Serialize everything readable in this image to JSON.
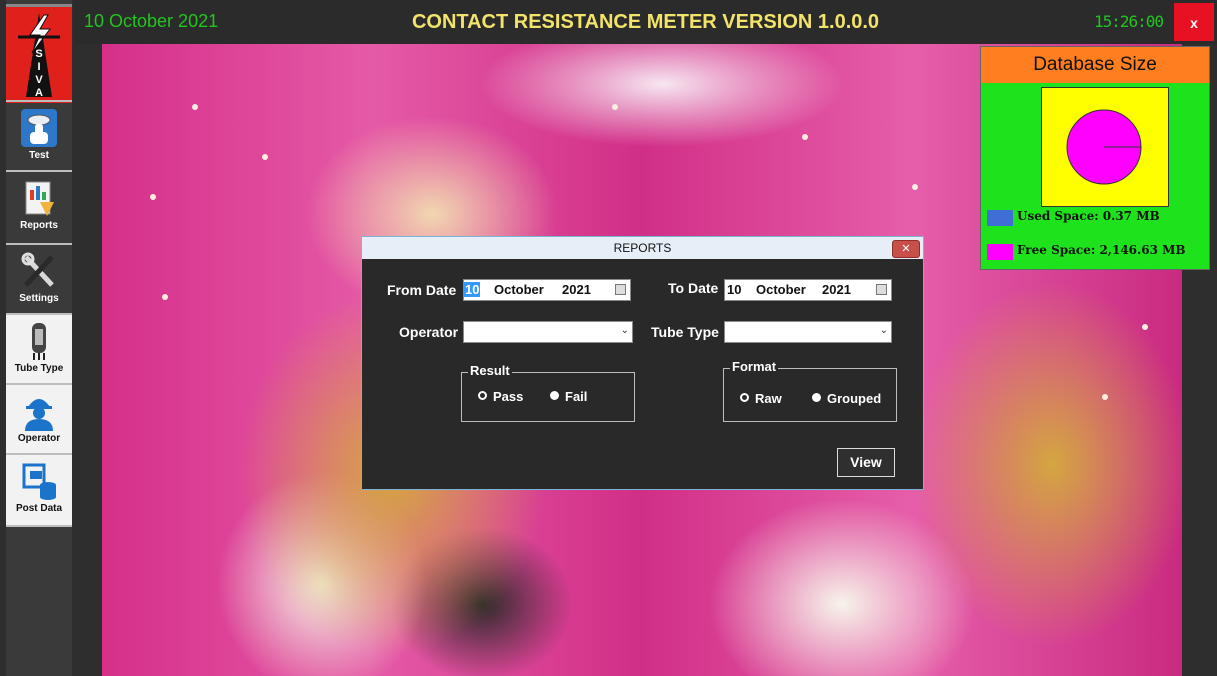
{
  "header": {
    "date": "10 October 2021",
    "title": "CONTACT RESISTANCE METER VERSION 1.0.0.0",
    "clock": "15:26:00",
    "close_label": "x"
  },
  "logo": {
    "letters": [
      "S",
      "I",
      "V",
      "A"
    ]
  },
  "sidebar": {
    "items": [
      {
        "label": "Test"
      },
      {
        "label": "Reports"
      },
      {
        "label": "Settings"
      },
      {
        "label": "Tube Type"
      },
      {
        "label": "Operator"
      },
      {
        "label": "Post Data"
      }
    ]
  },
  "database": {
    "title": "Database Size",
    "used_label": "Used Space: 0.37 MB",
    "free_label": "Free Space: 2,146.63 MB",
    "used_color": "#3f6fd6",
    "free_color": "#ff00ff"
  },
  "dialog": {
    "title": "REPORTS",
    "from_label": "From Date",
    "from_day": "10",
    "from_month": "October",
    "from_year": "2021",
    "to_label": "To Date",
    "to_day": "10",
    "to_month": "October",
    "to_year": "2021",
    "operator_label": "Operator",
    "operator_value": "",
    "tube_label": "Tube Type",
    "tube_value": "",
    "result_legend": "Result",
    "result_pass": "Pass",
    "result_fail": "Fail",
    "format_legend": "Format",
    "format_raw": "Raw",
    "format_grouped": "Grouped",
    "view_label": "View"
  }
}
